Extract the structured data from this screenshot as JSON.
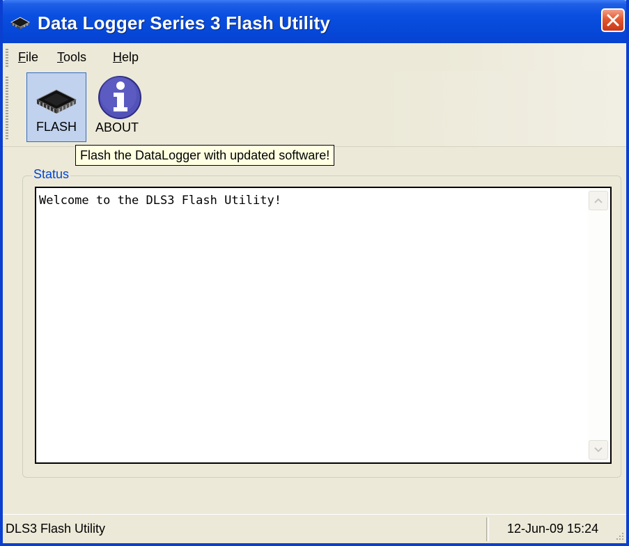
{
  "window": {
    "title": "Data Logger Series 3 Flash Utility",
    "icon": "chip-icon",
    "close_icon": "close-icon"
  },
  "menu": {
    "items": [
      {
        "label": "File",
        "mnemonic": "F"
      },
      {
        "label": "Tools",
        "mnemonic": "T"
      },
      {
        "label": "Help",
        "mnemonic": "H"
      }
    ]
  },
  "toolbar": {
    "buttons": [
      {
        "label": "FLASH",
        "icon": "chip-icon",
        "state": "hovered"
      },
      {
        "label": "ABOUT",
        "icon": "info-icon"
      }
    ]
  },
  "tooltip": {
    "text": "Flash the DataLogger with updated software!"
  },
  "status_group": {
    "label": "Status",
    "log_text": "Welcome to the DLS3 Flash Utility!"
  },
  "statusbar": {
    "left_text": "DLS3 Flash Utility",
    "datetime": "12-Jun-09 15:24"
  },
  "colors": {
    "titlebar": "#0546d6",
    "group_label": "#0046d5",
    "close_button": "#e2582f",
    "tooltip_bg": "#ffffe1"
  }
}
